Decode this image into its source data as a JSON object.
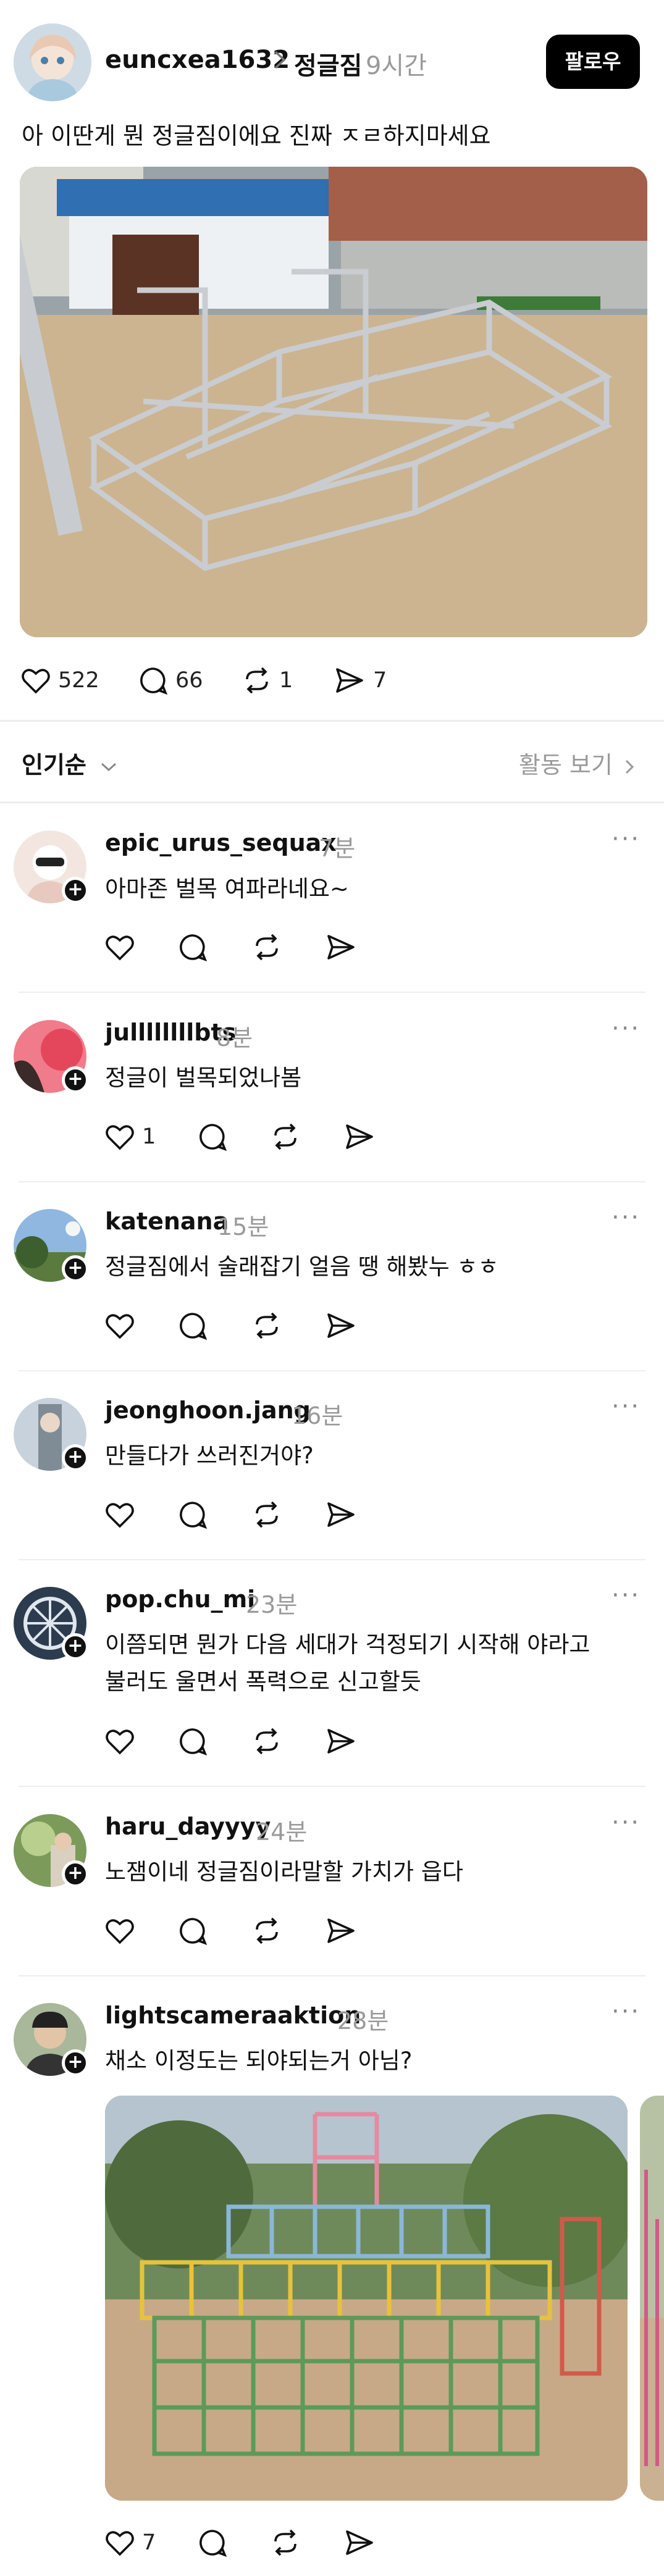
{
  "post": {
    "username": "euncxea1632",
    "topic": "정글짐",
    "time": "9시간",
    "follow_label": "팔로우",
    "text": "아 이딴게 뭔 정글짐이에요 진짜 ㅈㄹ하지마세요",
    "likes": "522",
    "comments": "66",
    "reposts": "1",
    "shares": "7"
  },
  "sort": {
    "label": "인기순",
    "activity_label": "활동 보기"
  },
  "replies": [
    {
      "username": "epic_urus_sequax",
      "time": "7분",
      "lines": [
        "아마존 벌목 여파라네요~"
      ],
      "likes": ""
    },
    {
      "username": "jullllllllbts",
      "time": "8분",
      "lines": [
        "정글이 벌목되었나봄"
      ],
      "likes": "1"
    },
    {
      "username": "katenana",
      "time": "15분",
      "lines": [
        "정글짐에서 술래잡기 얼음 땡 해봤누 ㅎㅎ"
      ],
      "likes": ""
    },
    {
      "username": "jeonghoon.jang",
      "time": "16분",
      "lines": [
        "만들다가 쓰러진거야?"
      ],
      "likes": ""
    },
    {
      "username": "pop.chu_mi",
      "time": "23분",
      "lines": [
        "이쯤되면 뭔가 다음 세대가 걱정되기 시작해 야라고",
        "불러도 울면서 폭력으로 신고할듯"
      ],
      "likes": ""
    },
    {
      "username": "haru_dayyyy",
      "time": "24분",
      "lines": [
        "노잼이네 정글짐이라말할 가치가 읍다"
      ],
      "likes": ""
    },
    {
      "username": "lightscameraaktion",
      "time": "28분",
      "lines": [
        "채소 이정도는 되야되는거 아님?"
      ],
      "likes": "7"
    }
  ],
  "colors": {
    "accent": "#000000",
    "muted": "#9a9a9a",
    "divider": "#eeeeee"
  }
}
